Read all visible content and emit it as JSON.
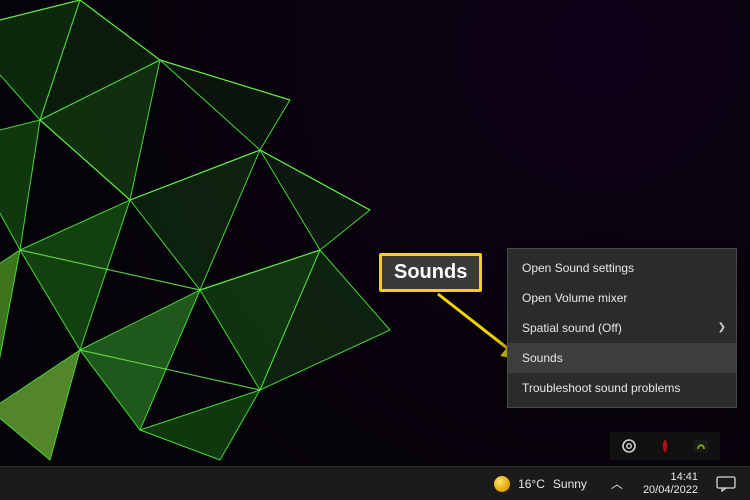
{
  "callout": {
    "label": "Sounds"
  },
  "context_menu": {
    "items": [
      {
        "label": "Open Sound settings",
        "submenu": false,
        "highlight": false
      },
      {
        "label": "Open Volume mixer",
        "submenu": false,
        "highlight": false
      },
      {
        "label": "Spatial sound (Off)",
        "submenu": true,
        "highlight": false
      },
      {
        "label": "Sounds",
        "submenu": false,
        "highlight": true
      },
      {
        "label": "Troubleshoot sound problems",
        "submenu": false,
        "highlight": false
      }
    ]
  },
  "taskbar": {
    "weather": {
      "temp": "16°C",
      "condition": "Sunny"
    },
    "clock": {
      "time": "14:41",
      "date": "20/04/2022"
    }
  },
  "icons": {
    "chevron_right": "❯",
    "tray_up": "︿"
  }
}
